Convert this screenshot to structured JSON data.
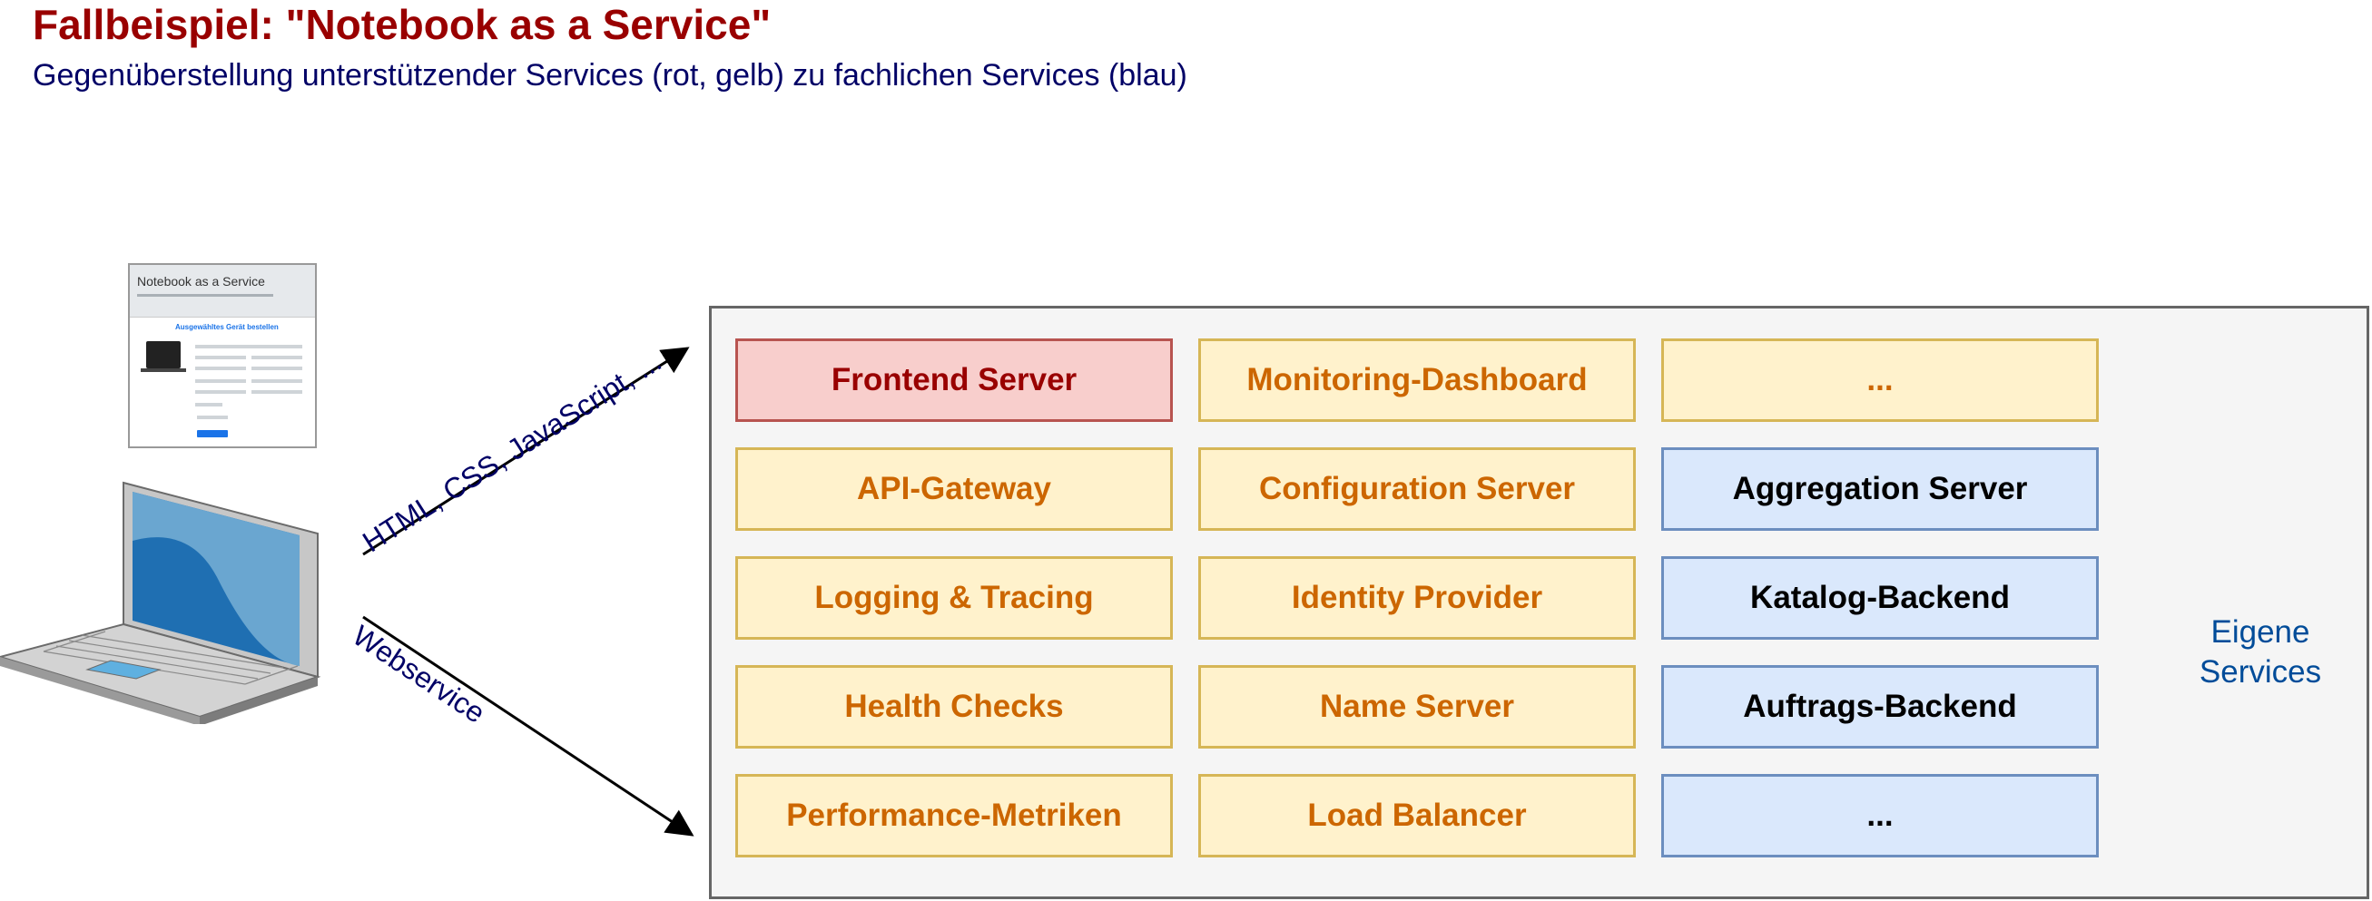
{
  "header": {
    "title": "Fallbeispiel: \"Notebook as a Service\"",
    "subtitle": "Gegenüberstellung unterstützender Services (rot, gelb) zu fachlichen Services (blau)"
  },
  "client": {
    "mockup_title": "Notebook as a Service",
    "mockup_heading": "Ausgewähltes Gerät bestellen"
  },
  "edges": {
    "frontend_label": "HTML, CSS, JavaScript, ...",
    "webservice_label": "Webservice"
  },
  "services": {
    "row1": [
      "Frontend Server",
      "Monitoring-Dashboard",
      "..."
    ],
    "row2": [
      "API-Gateway",
      "Configuration Server",
      "Aggregation Server"
    ],
    "row3": [
      "Logging & Tracing",
      "Identity Provider",
      "Katalog-Backend"
    ],
    "row4": [
      "Health Checks",
      "Name Server",
      "Auftrags-Backend"
    ],
    "row5": [
      "Performance-Metriken",
      "Load Balancer",
      "..."
    ]
  },
  "own_services": {
    "line1": "Eigene",
    "line2": "Services"
  },
  "colors": {
    "title": "#990000",
    "subtitle": "#000066",
    "frontend_fill": "#f8cecc",
    "supporting_fill": "#fff2cc",
    "supporting_text": "#cc6600",
    "business_fill": "#dae8fc",
    "brace": "#004c99"
  }
}
